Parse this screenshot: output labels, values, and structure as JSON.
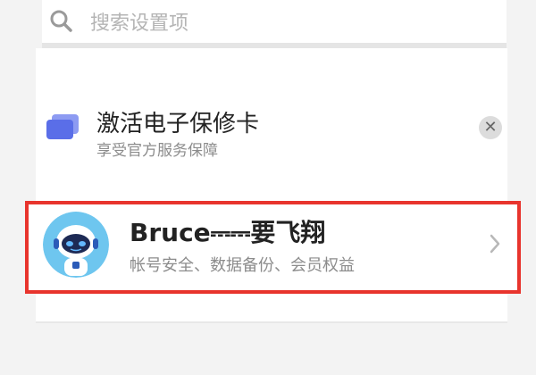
{
  "search": {
    "placeholder": "搜索设置项",
    "icon": "search-icon"
  },
  "warranty_card": {
    "title": "激活电子保修卡",
    "subtitle": "享受官方服务保障",
    "icon": "card-icon",
    "close_icon": "close-icon"
  },
  "account": {
    "name": "Bruce⎓⎓要飞翔",
    "description": "帐号安全、数据备份、会员权益",
    "avatar": "robot-avatar",
    "chevron": "chevron-right-icon",
    "highlight_color": "#e8342d"
  },
  "colors": {
    "background": "#f3f3f3",
    "card_icon": "#5a6ee8",
    "avatar_bg": "#6ec6ef"
  }
}
